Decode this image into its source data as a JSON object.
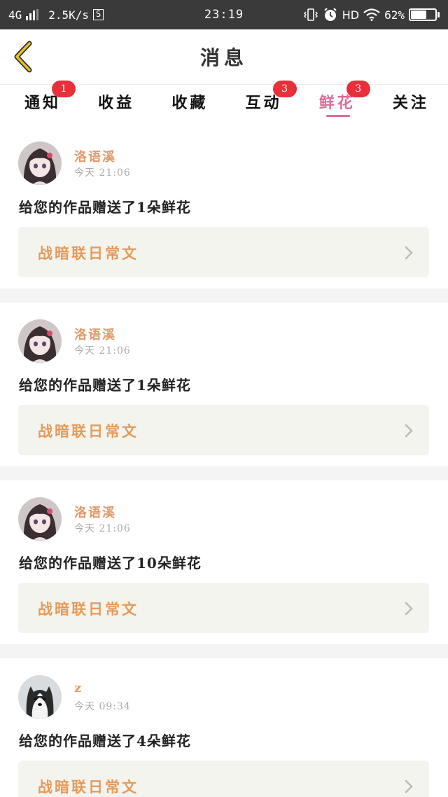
{
  "status_bar": {
    "network": "4G",
    "speed": "2.5K/s",
    "s_icon_text": "S",
    "time": "23:19",
    "hd": "HD",
    "battery": "62%"
  },
  "header": {
    "title": "消息"
  },
  "tabs": [
    {
      "label": "通知",
      "badge": "1"
    },
    {
      "label": "收益",
      "badge": ""
    },
    {
      "label": "收藏",
      "badge": ""
    },
    {
      "label": "互动",
      "badge": "3"
    },
    {
      "label": "鲜花",
      "badge": "3",
      "active": true
    },
    {
      "label": "关注",
      "badge": ""
    }
  ],
  "notifications": [
    {
      "user": "洛语溪",
      "time": "今天 21:06",
      "message": "给您的作品赠送了1朵鲜花",
      "work": "战暗联日常文",
      "avatar": "anime-girl-avatar"
    },
    {
      "user": "洛语溪",
      "time": "今天 21:06",
      "message": "给您的作品赠送了1朵鲜花",
      "work": "战暗联日常文",
      "avatar": "anime-girl-avatar"
    },
    {
      "user": "洛语溪",
      "time": "今天 21:06",
      "message": "给您的作品赠送了10朵鲜花",
      "work": "战暗联日常文",
      "avatar": "anime-girl-avatar"
    },
    {
      "user": "z",
      "time": "今天 09:34",
      "message": "给您的作品赠送了4朵鲜花",
      "work": "战暗联日常文",
      "avatar": "husky-dog-avatar"
    }
  ],
  "colors": {
    "accent_pink": "#e06a9a",
    "badge_red": "#e8303a",
    "username_orange": "#e29a6a",
    "work_title_orange": "#e69a5a",
    "back_arrow": "#e8c020"
  }
}
